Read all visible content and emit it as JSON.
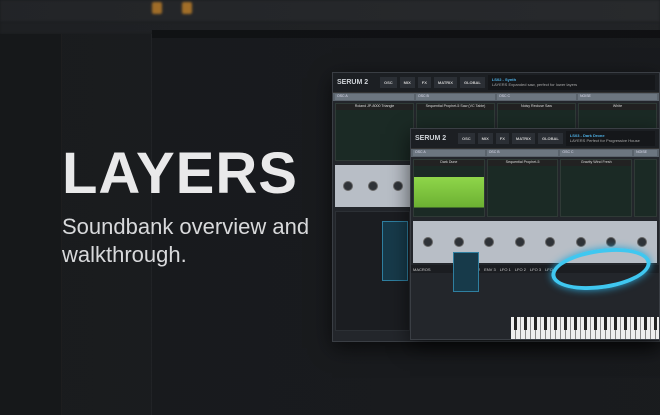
{
  "title": "LAYERS",
  "subtitle": "Soundbank overview and walkthrough.",
  "serum_windows": [
    {
      "logo": "SERUM 2",
      "tabs": [
        "OSC",
        "MIX",
        "FX",
        "MATRIX",
        "GLOBAL"
      ],
      "preset_name": "LS02 - Synth",
      "preset_description": "LAYERS Expanded saw, perfect for lower layers",
      "osc_sections": [
        "OSC A",
        "OSC B",
        "OSC C",
        "NOISE"
      ],
      "wavetables": [
        "Roland JP-8000 Triangle",
        "Sequential Prophet-5 Saw (VC Table)",
        "Noisy Recluse Saw",
        "White"
      ]
    },
    {
      "logo": "SERUM 2",
      "tabs": [
        "OSC",
        "MIX",
        "FX",
        "MATRIX",
        "GLOBAL"
      ],
      "preset_name": "LS03 - Dark Drone",
      "preset_description": "LAYERS Perfect for Progressive House",
      "osc_sections": [
        "OSC A",
        "OSC B",
        "OSC C",
        "NOISE"
      ],
      "wavetables": [
        "Dark Dune",
        "Sequential Prophet-5",
        "Gravity Wind Fresh"
      ],
      "lfo_tabs": [
        "ENV 1",
        "ENV 2",
        "ENV 3",
        "LFO 1",
        "LFO 2",
        "LFO 3",
        "LFO 4"
      ],
      "macro_label": "MACROS"
    }
  ],
  "colors": {
    "accent_blue": "#3fc7f0",
    "osc_green": "#8fd64a",
    "daw_orange": "#d8902e"
  }
}
